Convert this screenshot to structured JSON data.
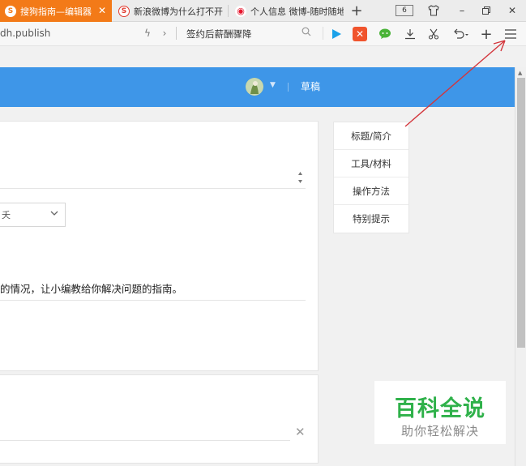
{
  "tabs": [
    {
      "label": "搜狗指南—编辑器",
      "icon": "sogou-icon",
      "active": true
    },
    {
      "label": "新浪微博为什么打不开",
      "icon": "sogou-icon",
      "active": false
    },
    {
      "label": "个人信息 微博-随时随地",
      "icon": "weibo-icon",
      "active": false
    }
  ],
  "tabbar": {
    "new_tab": "+",
    "tab_count": "6",
    "minimize": "–",
    "restore": "▫",
    "close": "✕"
  },
  "address": {
    "url": "dh.publish",
    "search_text": "签约后薪酬骤降"
  },
  "header": {
    "nav_label": "草稿"
  },
  "form": {
    "select_value": "夭",
    "description": "的情况，让小编教给你解决问题的指南。"
  },
  "sidenav": {
    "items": [
      "标题/简介",
      "工具/材料",
      "操作方法",
      "特别提示"
    ]
  },
  "watermark": {
    "title": "百科全说",
    "subtitle": "助你轻松解决"
  },
  "colors": {
    "accent": "#3e96e8",
    "tab_active": "#f37a18",
    "annotation_arrow": "#d3353b",
    "watermark_green": "#2fb14a"
  }
}
